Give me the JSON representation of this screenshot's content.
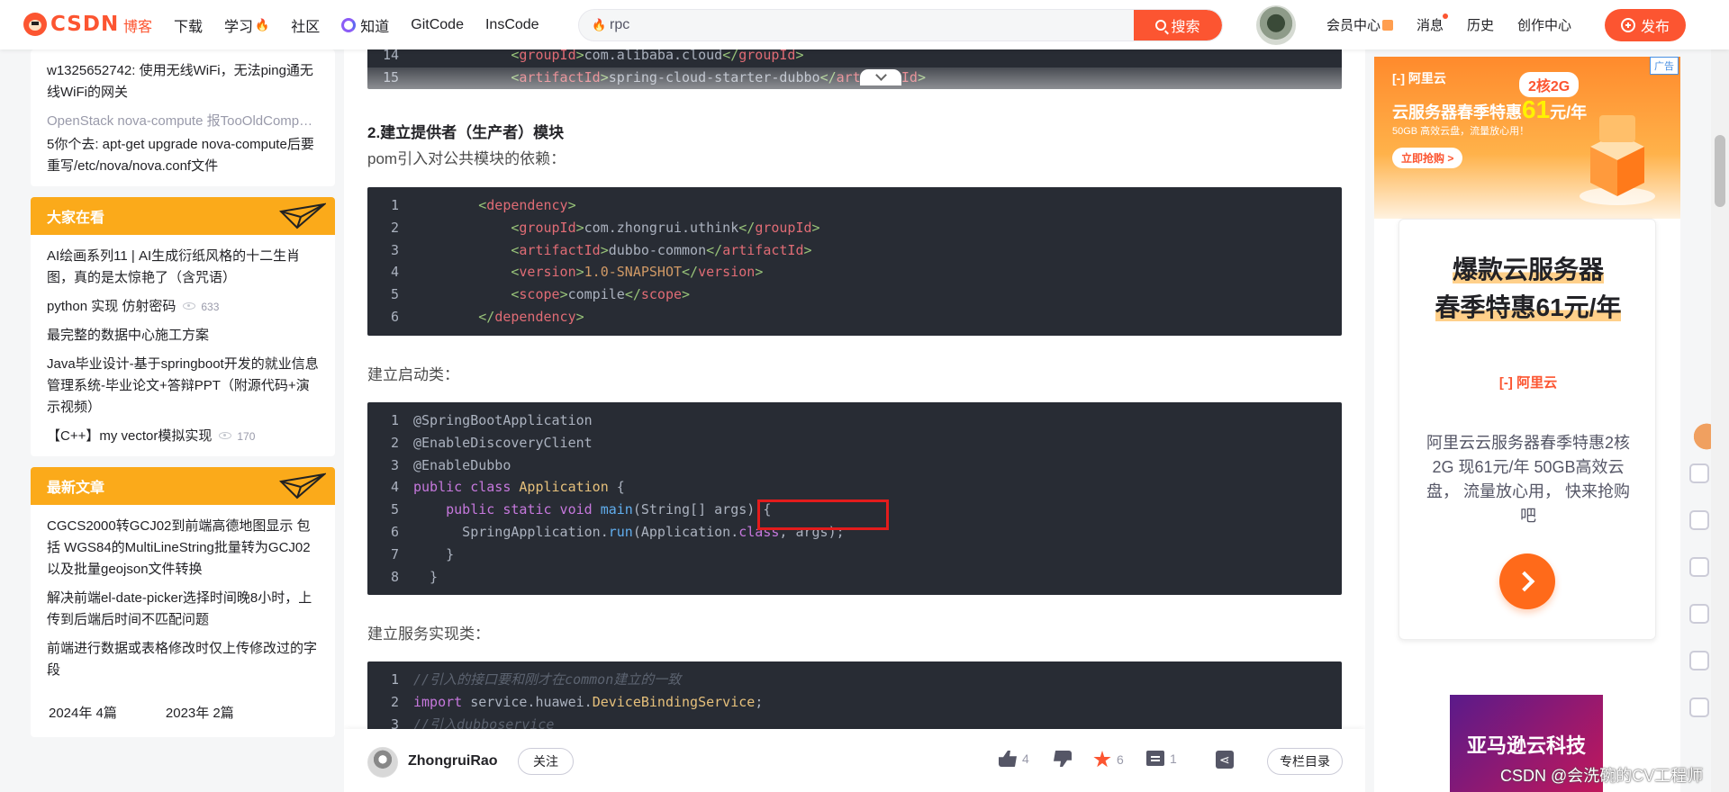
{
  "topbar": {
    "logo": "CSDN",
    "nav": [
      {
        "label": "博客",
        "active": true
      },
      {
        "label": "下载"
      },
      {
        "label": "学习",
        "flame": true
      },
      {
        "label": "社区"
      },
      {
        "label": "知道",
        "icon": "zhidao-icon"
      },
      {
        "label": "GitCode"
      },
      {
        "label": "InsCode"
      }
    ],
    "search_value": "rpc",
    "search_button": "搜索",
    "right_nav": [
      "会员中心",
      "消息",
      "历史",
      "创作中心"
    ],
    "publish": "发布"
  },
  "sidebar": {
    "recent_comments": [
      {
        "text": "w1325652742: 使用无线WiFi，无法ping通无线WiFi的网关",
        "gray": false
      },
      {
        "text": "OpenStack nova-compute 报TooOldComputeService错误",
        "gray": true
      },
      {
        "text": "5你个去: apt-get upgrade nova-compute后要重写/etc/nova/nova.conf文件",
        "gray": false
      }
    ],
    "popular": {
      "title": "大家在看",
      "items": [
        {
          "text": "AI绘画系列11 | AI生成衍纸风格的十二生肖图，真的是太惊艳了（含咒语）"
        },
        {
          "text": "python 实现 仿射密码",
          "views": "633"
        },
        {
          "text": "最完整的数据中心施工方案"
        },
        {
          "text": "Java毕业设计-基于springboot开发的就业信息管理系统-毕业论文+答辩PPT（附源代码+演示视频）"
        },
        {
          "text": "【C++】my vector模拟实现",
          "views": "170"
        }
      ]
    },
    "latest": {
      "title": "最新文章",
      "items": [
        {
          "text": "CGCS2000转GCJ02到前端高德地图显示 包括 WGS84的MultiLineString批量转为GCJ02以及批量geojson文件转换"
        },
        {
          "text": "解决前端el-date-picker选择时间晚8小时，上传到后端后时间不匹配问题"
        },
        {
          "text": "前端进行数据或表格修改时仅上传修改过的字段"
        }
      ],
      "archive": [
        "2024年 4篇",
        "2023年 2篇"
      ]
    }
  },
  "article": {
    "section_title": "2.建立提供者（生产者）模块",
    "pom_intro": "pom引入对公共模块的依赖：",
    "startup_intro": "建立启动类：",
    "impl_intro": "建立服务实现类：",
    "top_code": [
      {
        "n": "14",
        "indent": "            ",
        "tag": "groupId",
        "val": "com.alibaba.cloud"
      },
      {
        "n": "15",
        "indent": "            ",
        "tag": "artifactId",
        "val": "spring-cloud-starter-dubbo"
      }
    ],
    "pom_code": [
      {
        "n": "1",
        "indent": "        ",
        "open": "dependency"
      },
      {
        "n": "2",
        "indent": "            ",
        "tag": "groupId",
        "val": "com.zhongrui.uthink"
      },
      {
        "n": "3",
        "indent": "            ",
        "tag": "artifactId",
        "val": "dubbo-common"
      },
      {
        "n": "4",
        "indent": "            ",
        "tag": "version",
        "val": "1.0-SNAPSHOT"
      },
      {
        "n": "5",
        "indent": "            ",
        "tag": "scope",
        "val": "compile"
      },
      {
        "n": "6",
        "indent": "        ",
        "close": "dependency"
      }
    ],
    "app_code": [
      [
        "1",
        "@SpringBootApplication"
      ],
      [
        "2",
        "@EnableDiscoveryClient"
      ],
      [
        "3",
        "@EnableDubbo"
      ],
      [
        "4",
        "public class Application {"
      ],
      [
        "5",
        "    public static void main(String[] args) {"
      ],
      [
        "6",
        "        SpringApplication.run(Application.class, args);"
      ],
      [
        "7",
        "    }"
      ],
      [
        "8",
        "}"
      ]
    ],
    "impl_code": [
      [
        "1",
        "//引入的接口要和刚才在common建立的一致"
      ],
      [
        "2",
        "import service.huawei.DeviceBindingService;"
      ],
      [
        "3",
        "//引入dubboservice"
      ]
    ]
  },
  "toolbar": {
    "author": "ZhongruiRao",
    "follow": "关注",
    "likes": "4",
    "favorites": "6",
    "comments": "1",
    "catalog": "专栏目录"
  },
  "ad": {
    "tag": "广告",
    "logo": "阿里云",
    "badge": "2核2G",
    "headline_pre": "云服务器春季特惠",
    "headline_price": "61",
    "headline_unit": "元/年",
    "sub": "50GB 高效云盘，流量放心用！",
    "cta": "立即抢购 >",
    "card_title_1": "爆款云服务器",
    "card_title_2": "春季特惠61元/年",
    "card_logo": "阿里云",
    "card_text": "阿里云云服务器春季特惠2核2G 现61元/年 50GB高效云盘， 流量放心用， 快来抢购吧",
    "ad2_text": "亚马逊云科技"
  },
  "watermark": "CSDN @会洗碗的CV工程师"
}
